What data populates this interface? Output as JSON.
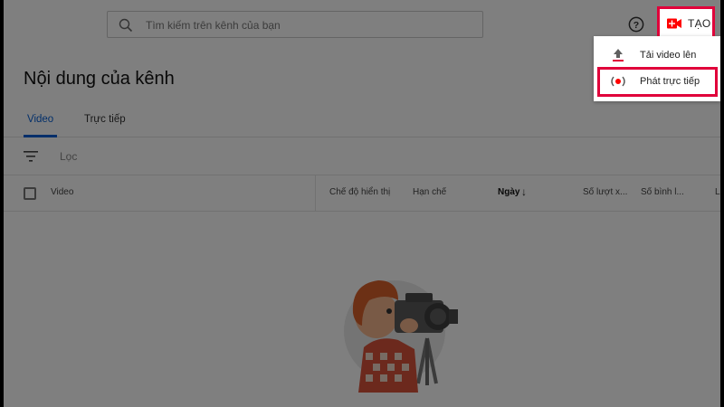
{
  "search": {
    "placeholder": "Tìm kiếm trên kênh của bạn"
  },
  "header": {
    "create_label": "TẠO"
  },
  "create_menu": {
    "items": [
      {
        "label": "Tải video lên",
        "icon": "upload-icon"
      },
      {
        "label": "Phát trực tiếp",
        "icon": "live-broadcast-icon"
      }
    ]
  },
  "page": {
    "title": "Nội dung của kênh"
  },
  "tabs": [
    {
      "label": "Video",
      "active": true
    },
    {
      "label": "Trực tiếp",
      "active": false
    }
  ],
  "filter": {
    "label": "Lọc"
  },
  "table": {
    "columns": [
      "Video",
      "Chế độ hiển thị",
      "Hạn chế",
      "Ngày",
      "Số lượt x...",
      "Số bình l...",
      "L"
    ],
    "sort_arrow": "↓"
  },
  "colors": {
    "accent": "#065fd4",
    "highlight": "#e0003a",
    "brand_red": "#ff0000"
  }
}
